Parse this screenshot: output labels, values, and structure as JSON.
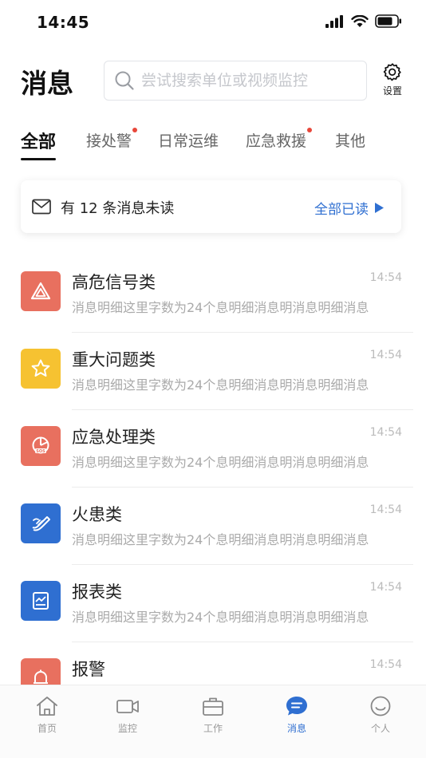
{
  "status_bar": {
    "time": "14:45"
  },
  "header": {
    "title": "消息",
    "search_placeholder": "尝试搜索单位或视频监控",
    "settings_label": "设置"
  },
  "tabs": [
    {
      "label": "全部",
      "active": true,
      "dot": false
    },
    {
      "label": "接处警",
      "active": false,
      "dot": true
    },
    {
      "label": "日常运维",
      "active": false,
      "dot": false
    },
    {
      "label": "应急救援",
      "active": false,
      "dot": true
    },
    {
      "label": "其他",
      "active": false,
      "dot": false
    }
  ],
  "unread": {
    "text": "有 12 条消息未读",
    "action_label": "全部已读"
  },
  "messages": [
    {
      "icon": "warning-triangle-icon",
      "color": "#e8705f",
      "title": "高危信号类",
      "time": "14:54",
      "preview": "消息明细这里字数为24个息明细消息明消息明细消息"
    },
    {
      "icon": "star-icon",
      "color": "#f6c231",
      "title": "重大问题类",
      "time": "14:54",
      "preview": "消息明细这里字数为24个息明细消息明消息明细消息"
    },
    {
      "icon": "sos-pie-icon",
      "color": "#e8705f",
      "title": "应急处理类",
      "time": "14:54",
      "preview": "消息明细这里字数为24个息明细消息明消息明细消息"
    },
    {
      "icon": "fire-hose-icon",
      "color": "#2f6fd1",
      "title": "火患类",
      "time": "14:54",
      "preview": "消息明细这里字数为24个息明细消息明消息明细消息"
    },
    {
      "icon": "report-chart-icon",
      "color": "#2f6fd1",
      "title": "报表类",
      "time": "14:54",
      "preview": "消息明细这里字数为24个息明细消息明消息明细消息"
    },
    {
      "icon": "alarm-bell-icon",
      "color": "#e8705f",
      "title": "报警",
      "time": "14:54",
      "preview": ""
    }
  ],
  "nav": [
    {
      "label": "首页",
      "icon": "home-icon",
      "active": false
    },
    {
      "label": "监控",
      "icon": "video-camera-icon",
      "active": false
    },
    {
      "label": "工作",
      "icon": "briefcase-icon",
      "active": false
    },
    {
      "label": "消息",
      "icon": "message-icon",
      "active": true
    },
    {
      "label": "个人",
      "icon": "smiley-profile-icon",
      "active": false
    }
  ],
  "colors": {
    "accent": "#2f6fd1",
    "red_dot": "#e8473a",
    "icon_red": "#e8705f",
    "icon_yellow": "#f6c231",
    "icon_blue": "#2f6fd1"
  }
}
